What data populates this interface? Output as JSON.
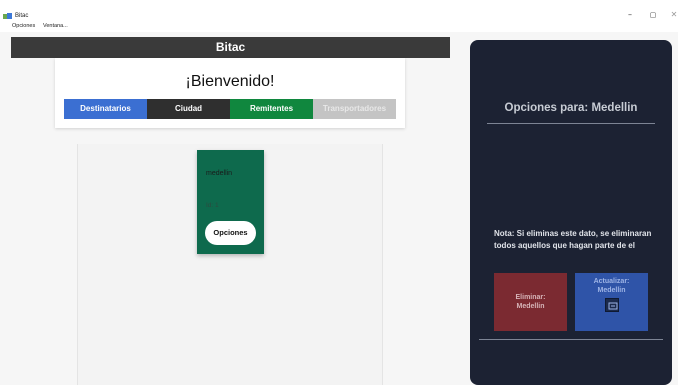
{
  "window": {
    "title": "Bitac",
    "minimize_glyph": "–",
    "maximize_glyph": "▢",
    "close_glyph": "✕"
  },
  "menu": {
    "items": [
      "Opciones",
      "Ventana..."
    ]
  },
  "header": {
    "title": "Bitac"
  },
  "welcome": {
    "title": "¡Bienvenido!",
    "tabs": [
      {
        "label": "Destinatarios",
        "color": "#3b6fd2"
      },
      {
        "label": "Ciudad",
        "color": "#2f2f2f"
      },
      {
        "label": "Remitentes",
        "color": "#10873e"
      },
      {
        "label": "Transportadores",
        "color": "#c4c4c4"
      }
    ]
  },
  "city_card": {
    "name": "medellin",
    "id_text": "Id: 1",
    "options_label": "Opciones",
    "color": "#0e6a4d"
  },
  "options_panel": {
    "title": "Opciones para: Medellin",
    "note": "Nota: Si eliminas este dato, se eliminaran todos aquellos que hagan parte de el",
    "delete_line1": "Eliminar:",
    "delete_line2": "Medellin",
    "update_line1": "Actualizar:",
    "update_line2": "Medellin",
    "update_icon": "edit-icon",
    "colors": {
      "panel": "#1c2233",
      "delete": "#7b2a31",
      "update": "#2f54a8"
    }
  }
}
